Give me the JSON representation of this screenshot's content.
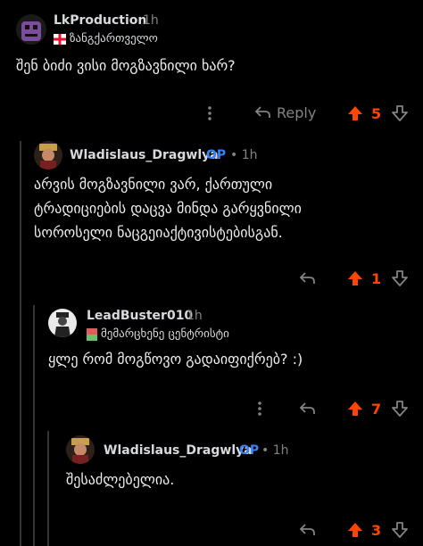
{
  "colors": {
    "background": "#000000",
    "text": "#d7dadc",
    "muted": "#818384",
    "upvote": "#ff4500",
    "op": "#3b82f6"
  },
  "comments": [
    {
      "author": "LkProduction",
      "time": "1h",
      "flair": "ზანგქართველო",
      "flair_icon": "red-cross-flag-icon",
      "body": "შენ ბიძი ვისი მოგზავნილი ხარ?",
      "reply_label": "Reply",
      "score": "5"
    },
    {
      "author": "Wladislaus_Dragwlya",
      "op_label": "OP",
      "time": "1h",
      "body_lines": [
        "არვის მოგზავნილი ვარ, ქართული",
        "ტრადიციების დაცვა მინდა გარყვნილი",
        "სოროსელი ნაცგეიაქტივისტებისგან."
      ],
      "score": "1"
    },
    {
      "author": "LeadBuster010",
      "time": "1h",
      "flair": "მემარცხენე ცენტრისტი",
      "flair_icon": "green-red-flag-icon",
      "body": "ყლე რომ მოგწოვო გადაიფიქრებ? :)",
      "score": "7"
    },
    {
      "author": "Wladislaus_Dragwlya",
      "op_label": "OP",
      "time": "1h",
      "body": "შესაძლებელია.",
      "score": "3"
    }
  ]
}
